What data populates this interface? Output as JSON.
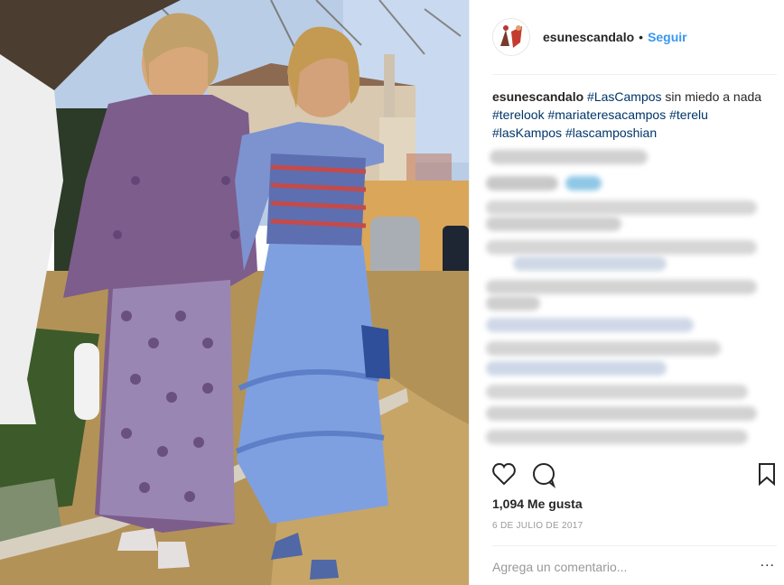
{
  "post": {
    "username": "esunescandalo",
    "separator": "•",
    "follow_label": "Seguir",
    "caption": {
      "username": "esunescandalo",
      "hashtag_1": "#LasCampos",
      "text_1": " sin miedo a nada ",
      "hashtag_2": "#terelook",
      "hashtag_3": "#mariateresacampos",
      "hashtag_4": "#terelu",
      "hashtag_5": "#lasKampos",
      "hashtag_6": "#lascamposhian"
    },
    "likes": "1,094 Me gusta",
    "date": "6 DE JULIO DE 2017",
    "comment_placeholder": "Agrega un comentario...",
    "more_label": "..."
  },
  "icons": {
    "like": "heart-icon",
    "comment": "comment-icon",
    "save": "bookmark-icon"
  },
  "colors": {
    "link_blue": "#3897f0",
    "hashtag": "#003569",
    "muted": "#999999"
  }
}
